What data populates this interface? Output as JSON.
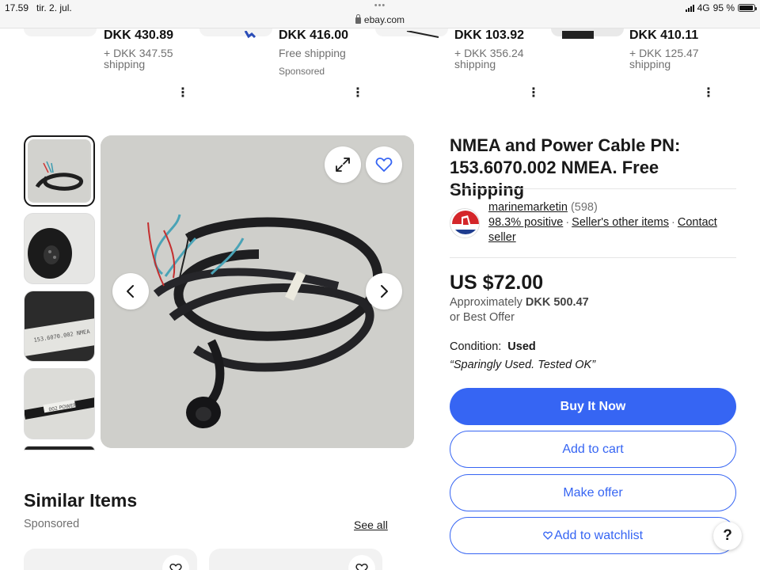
{
  "status_bar": {
    "time": "17.59",
    "date": "tir. 2. jul.",
    "url": "ebay.com",
    "network": "4G",
    "battery": "95 %",
    "battery_level": 0.95
  },
  "top_carousel": {
    "items": [
      {
        "price": "DKK 430.89",
        "shipping": "+ DKK 347.55 shipping",
        "sponsored": ""
      },
      {
        "price": "DKK 416.00",
        "shipping": "Free shipping",
        "sponsored": "Sponsored"
      },
      {
        "price": "DKK 103.92",
        "shipping": "+ DKK 356.24 shipping",
        "sponsored": ""
      },
      {
        "price": "DKK 410.11",
        "shipping": "+ DKK 125.47 shipping",
        "sponsored": ""
      }
    ]
  },
  "gallery": {
    "thumbnail_count_visible": 5,
    "active_index": 0
  },
  "listing": {
    "title": "NMEA and Power Cable PN: 153.6070.002 NMEA. Free Shipping",
    "seller": {
      "name": "marinemarketin",
      "feedback_count": "(598)",
      "positive": "98.3% positive",
      "other_items": "Seller's other items",
      "contact": "Contact seller"
    },
    "price": "US $72.00",
    "approx_prefix": "Approximately",
    "approx_value": "DKK 500.47",
    "best_offer": "or Best Offer",
    "condition_label": "Condition:",
    "condition_value": "Used",
    "condition_note": "“Sparingly Used. Tested OK”",
    "buttons": {
      "buy_now": "Buy It Now",
      "add_to_cart": "Add to cart",
      "make_offer": "Make offer",
      "watchlist": "Add to watchlist"
    }
  },
  "similar": {
    "title": "Similar Items",
    "sponsored": "Sponsored",
    "see_all": "See all"
  },
  "help": {
    "label": "?"
  },
  "colors": {
    "accent": "#3665f3",
    "text": "#191919",
    "muted": "#707070"
  }
}
